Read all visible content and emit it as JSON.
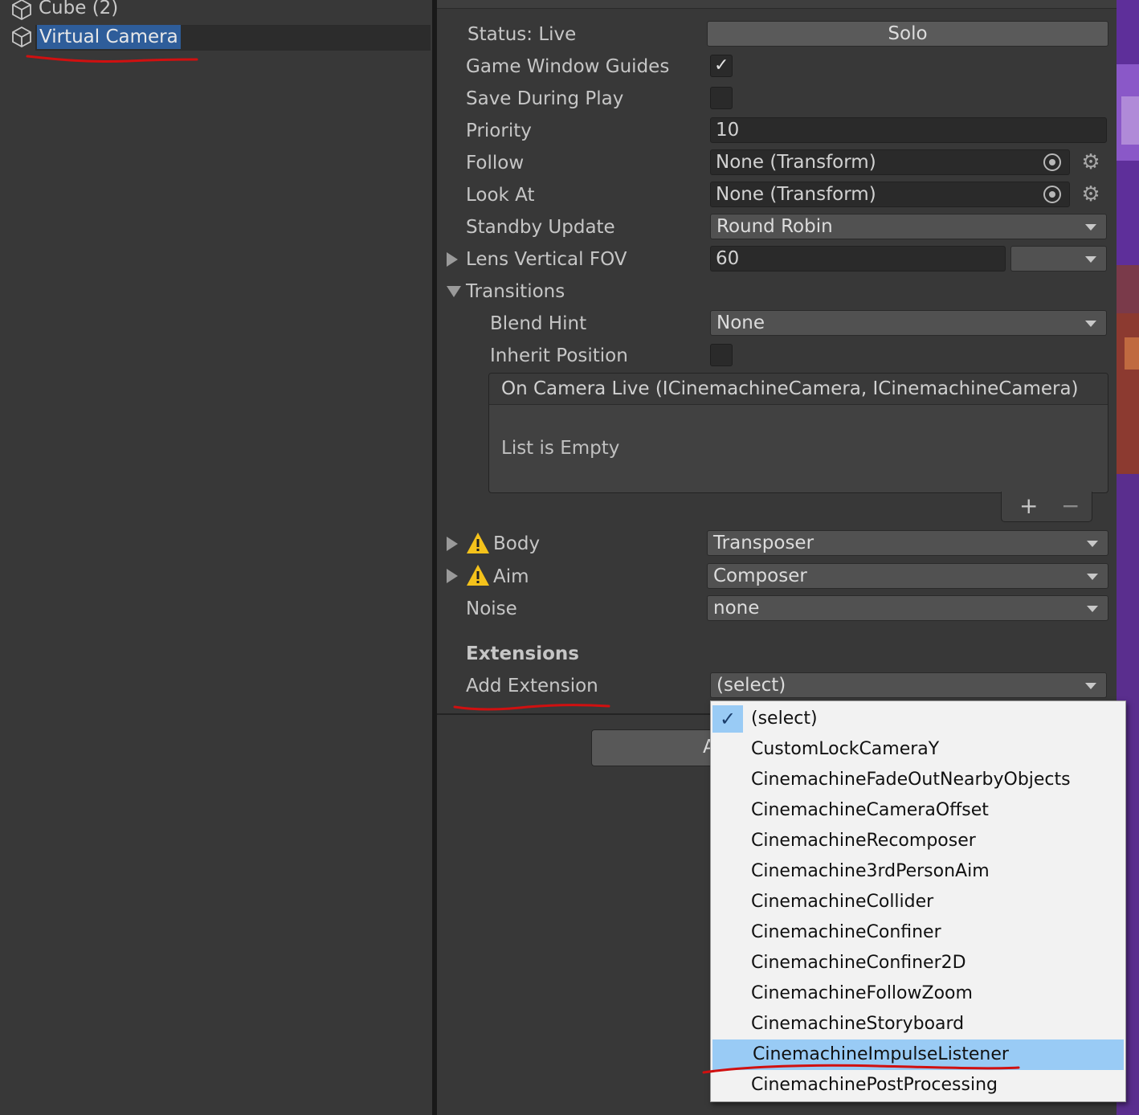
{
  "hierarchy": {
    "items": [
      {
        "label": "Cube (2)",
        "icon": "cube-icon"
      },
      {
        "label": "Virtual Camera",
        "icon": "cube-icon",
        "selected": true
      }
    ]
  },
  "inspector": {
    "status_label": "Status: Live",
    "solo_button": "Solo",
    "game_window_guides": {
      "label": "Game Window Guides",
      "checked": true
    },
    "save_during_play": {
      "label": "Save During Play",
      "checked": false
    },
    "priority": {
      "label": "Priority",
      "value": "10"
    },
    "follow": {
      "label": "Follow",
      "value": "None (Transform)"
    },
    "look_at": {
      "label": "Look At",
      "value": "None (Transform)"
    },
    "standby_update": {
      "label": "Standby Update",
      "value": "Round Robin"
    },
    "lens": {
      "label": "Lens Vertical FOV",
      "value": "60",
      "preset": ""
    },
    "transitions": {
      "label": "Transitions",
      "blend_hint": {
        "label": "Blend Hint",
        "value": "None"
      },
      "inherit_position": {
        "label": "Inherit Position",
        "checked": false
      },
      "event": {
        "header": "On Camera Live (ICinemachineCamera, ICinemachineCamera)",
        "empty_text": "List is Empty",
        "add": "+",
        "remove": "−"
      }
    },
    "body": {
      "label": "Body",
      "value": "Transposer"
    },
    "aim": {
      "label": "Aim",
      "value": "Composer"
    },
    "noise": {
      "label": "Noise",
      "value": "none"
    },
    "extensions_header": "Extensions",
    "add_extension": {
      "label": "Add Extension",
      "value": "(select)"
    },
    "add_component_partial": "A"
  },
  "popup_menu": {
    "items": [
      "(select)",
      "CustomLockCameraY",
      "CinemachineFadeOutNearbyObjects",
      "CinemachineCameraOffset",
      "CinemachineRecomposer",
      "Cinemachine3rdPersonAim",
      "CinemachineCollider",
      "CinemachineConfiner",
      "CinemachineConfiner2D",
      "CinemachineFollowZoom",
      "CinemachineStoryboard",
      "CinemachineImpulseListener",
      "CinemachinePostProcessing"
    ],
    "checked_item": "(select)",
    "highlighted_item": "CinemachineImpulseListener"
  },
  "colors": {
    "panel_bg": "#383838",
    "selection": "#2e5d9a",
    "menu_highlight": "#99cbf5",
    "annotation_red": "#d01010"
  }
}
